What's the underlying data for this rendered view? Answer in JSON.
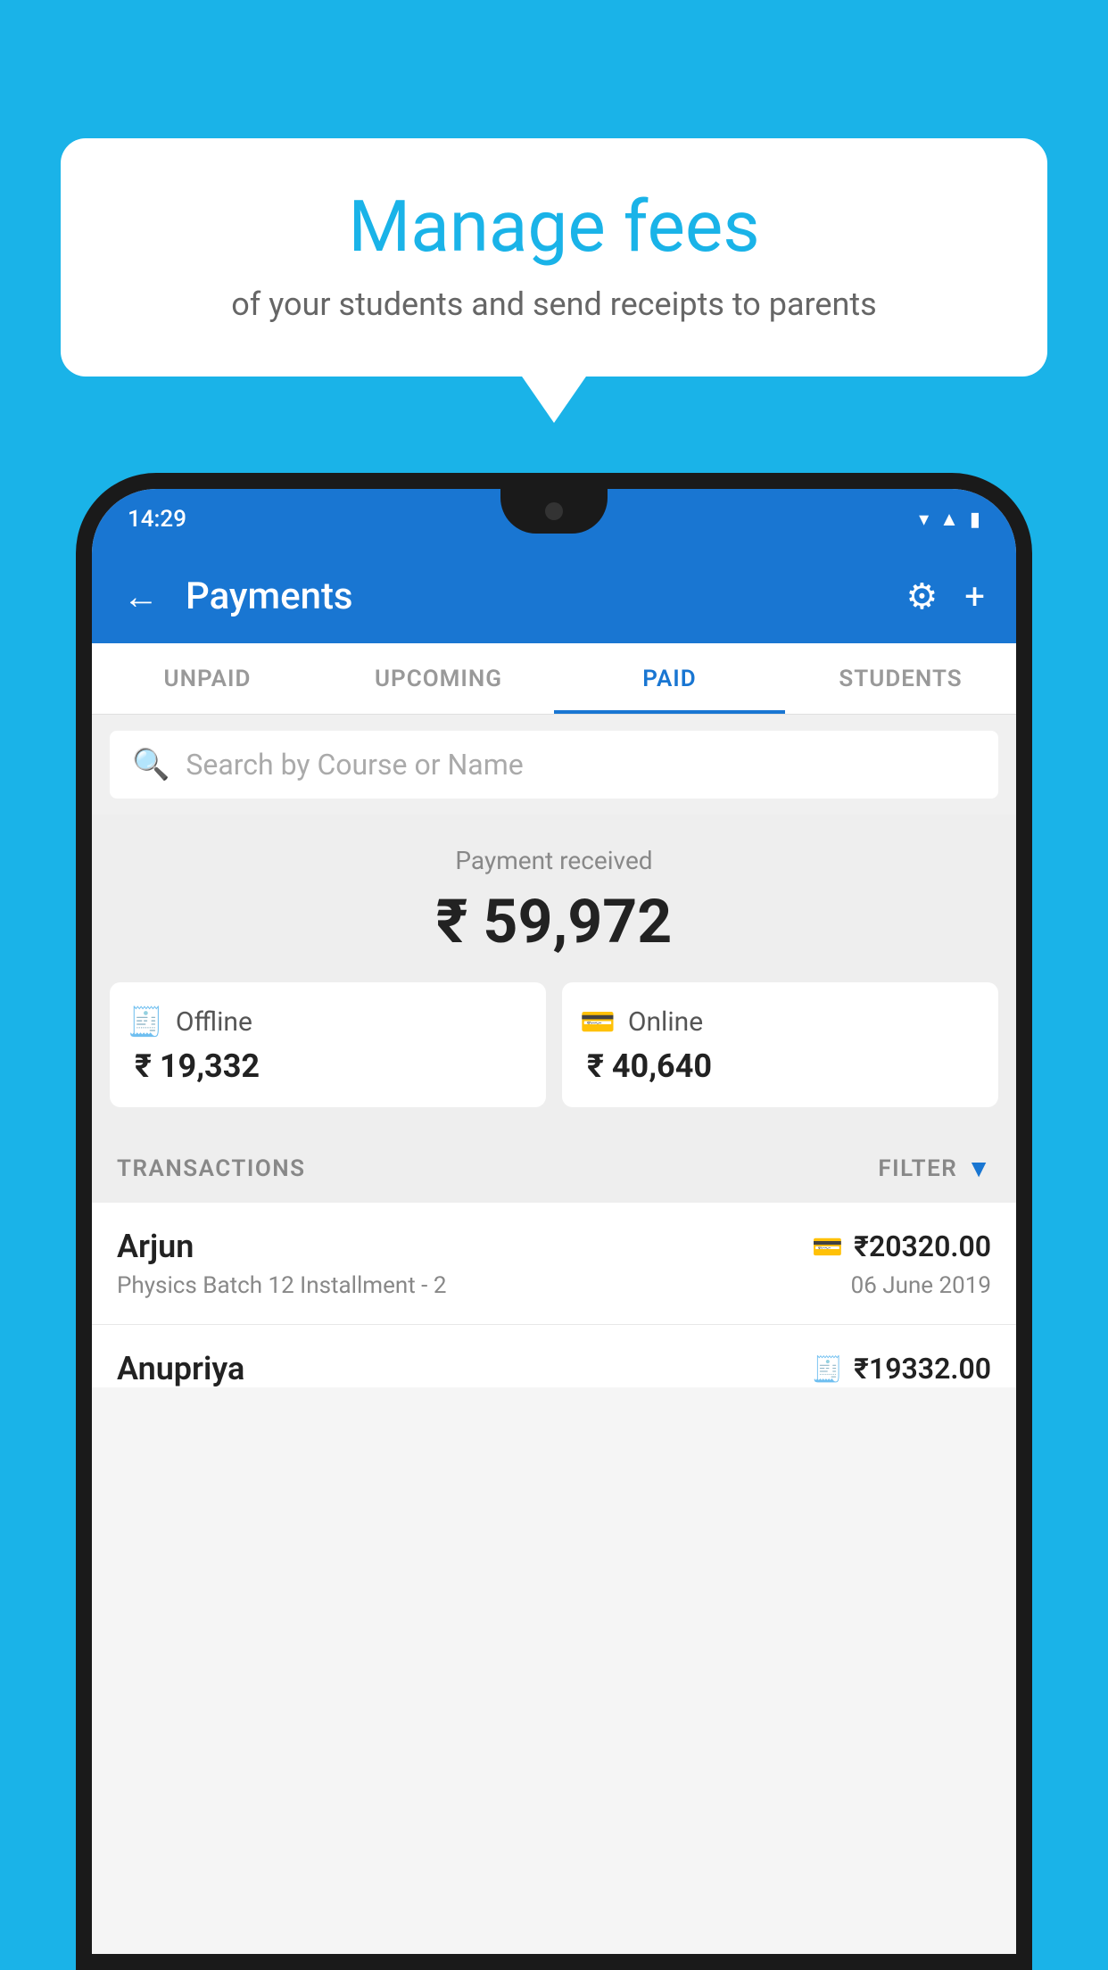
{
  "background_color": "#1ab3e8",
  "bubble": {
    "title": "Manage fees",
    "subtitle": "of your students and send receipts to parents"
  },
  "status_bar": {
    "time": "14:29"
  },
  "app_bar": {
    "title": "Payments",
    "back_label": "←",
    "settings_label": "⚙",
    "add_label": "+"
  },
  "tabs": [
    {
      "id": "unpaid",
      "label": "UNPAID",
      "active": false
    },
    {
      "id": "upcoming",
      "label": "UPCOMING",
      "active": false
    },
    {
      "id": "paid",
      "label": "PAID",
      "active": true
    },
    {
      "id": "students",
      "label": "STUDENTS",
      "active": false
    }
  ],
  "search": {
    "placeholder": "Search by Course or Name"
  },
  "payment_summary": {
    "label": "Payment received",
    "total": "₹ 59,972",
    "offline": {
      "label": "Offline",
      "amount": "₹ 19,332"
    },
    "online": {
      "label": "Online",
      "amount": "₹ 40,640"
    }
  },
  "transactions": {
    "header_label": "TRANSACTIONS",
    "filter_label": "FILTER",
    "items": [
      {
        "name": "Arjun",
        "course": "Physics Batch 12 Installment - 2",
        "amount": "₹20320.00",
        "date": "06 June 2019",
        "type": "online"
      },
      {
        "name": "Anupriya",
        "course": "",
        "amount": "₹19332.00",
        "date": "",
        "type": "offline"
      }
    ]
  }
}
